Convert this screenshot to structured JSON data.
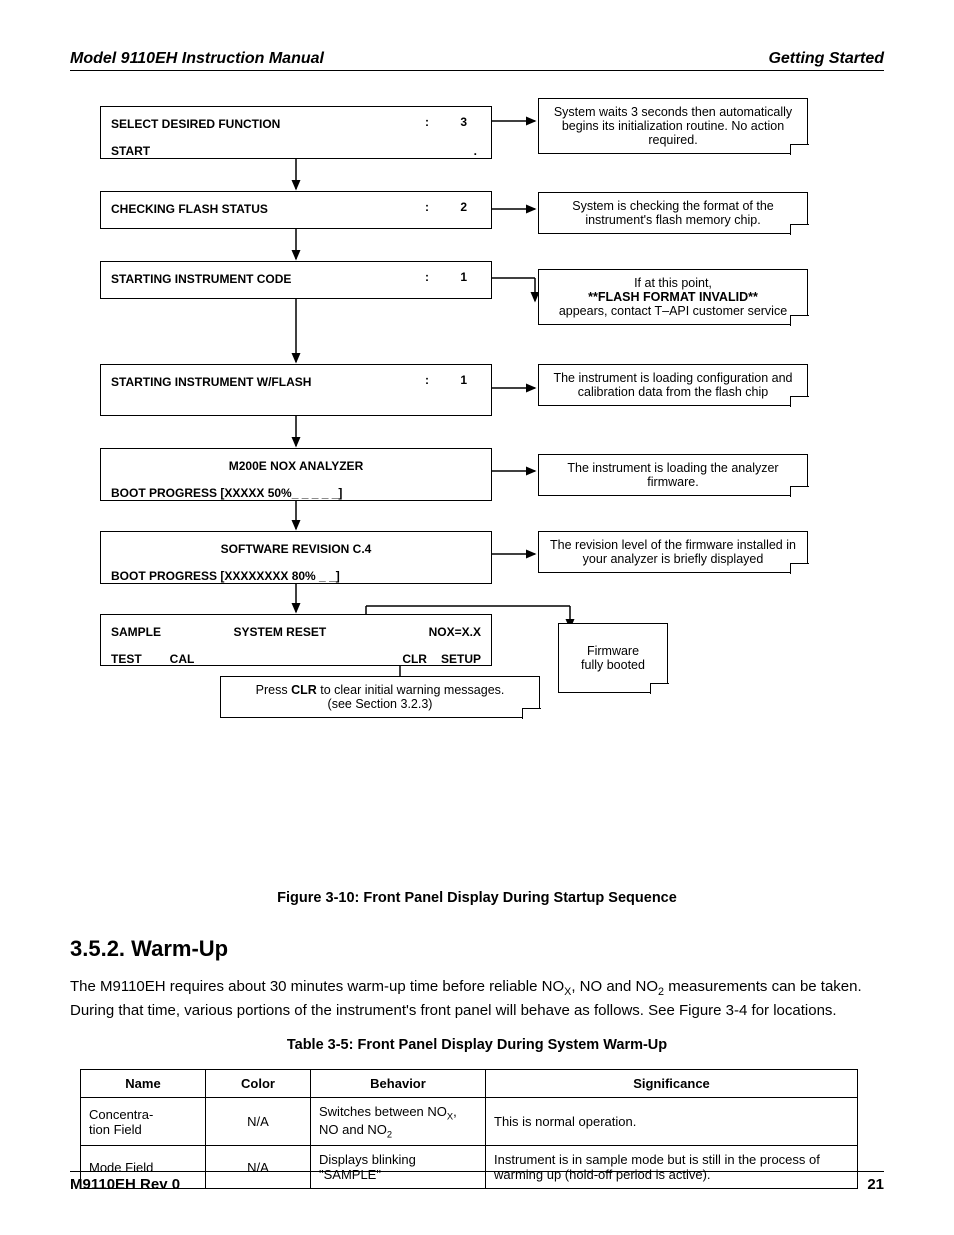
{
  "header": {
    "left": "Model 9110EH Instruction Manual",
    "right": "Getting Started"
  },
  "lcd": [
    {
      "row1_left": "SELECT DESIRED FUNCTION",
      "row1_right": ": 3",
      "row2_left": "START",
      "row2_right": "."
    },
    {
      "row1_left": "CHECKING FLASH STATUS",
      "row1_right": ": 2"
    },
    {
      "row1_left": "STARTING INSTRUMENT CODE",
      "row1_right": ": 1"
    },
    {
      "row1_left": "STARTING INSTRUMENT  W/FLASH",
      "row1_right": ": 1"
    },
    {
      "row1_center": "M200E NOX ANALYZER",
      "row2_left": "BOOT PROGRESS [XXXXX 50%_ _ _ _ _]"
    },
    {
      "row1_center": "SOFTWARE REVISION C.4",
      "row2_left": "BOOT PROGRESS [XXXXXXXX 80%  _ _]"
    },
    {
      "sample": "SAMPLE",
      "sysreset": "SYSTEM RESET",
      "nox": "NOX=X.X",
      "test": "TEST",
      "cal": "CAL",
      "clr": "CLR",
      "setup": "SETUP"
    }
  ],
  "callouts": [
    "System waits 3 seconds then automatically begins its initialization routine. No action required.",
    "System is checking the format of the instrument's flash memory chip.",
    {
      "pre": "If at this point,",
      "bold": "**FLASH FORMAT INVALID**",
      "post": "appears, contact T–API customer service"
    },
    "The instrument is loading configuration and calibration data from  the flash chip",
    "The instrument is loading the analyzer firmware.",
    "The revision level of the firmware installed in your analyzer is briefly displayed",
    "Firmware\nfully booted",
    {
      "pre": "Press",
      "bold": "CLR",
      "post": "to clear initial warning messages.\n(see Section 3.2.3)"
    }
  ],
  "figure_caption": "Figure 3-10: Front Panel Display During Startup Sequence",
  "section": {
    "title": "3.5.2. Warm-Up",
    "paragraph_parts": [
      "The M9110EH requires about 30 minutes warm-up time before reliable NO",
      ", NO and NO",
      " measurements can be taken. During that time, various portions of the instrument's front panel will behave as follows. See Figure 3-4 for locations."
    ],
    "sub1": "X",
    "sub2": "2"
  },
  "table_caption": "Table 3-5:    Front Panel Display During System Warm-Up",
  "table": {
    "headers": [
      "Name",
      "Color",
      "Behavior",
      "Significance"
    ],
    "rows": [
      {
        "name": "Concentra-\ntion Field",
        "color": "N/A",
        "behavior_parts": [
          "Switches between NO",
          ", NO and NO",
          ""
        ],
        "behavior_sub1": "X",
        "behavior_sub2": "2",
        "significance": "This is normal operation."
      },
      {
        "name": "Mode Field",
        "color": "N/A",
        "behavior": "Displays blinking \"SAMPLE\"",
        "significance": "Instrument is in sample mode but is still in the process of warming up (hold-off period is active)."
      }
    ]
  },
  "footer": {
    "left": "M9110EH Rev 0",
    "right": "21"
  }
}
